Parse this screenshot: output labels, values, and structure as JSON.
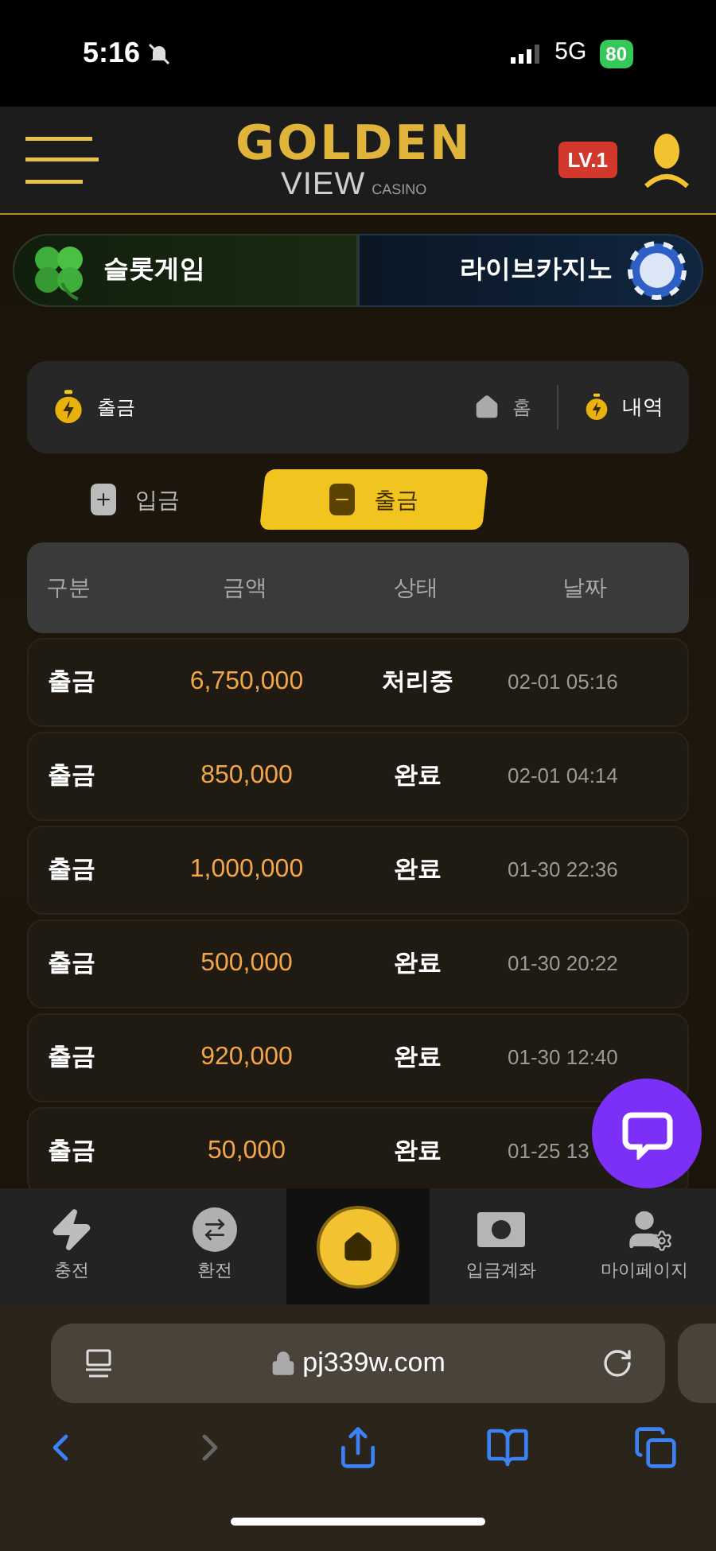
{
  "status_bar": {
    "time": "5:16",
    "network": "5G",
    "battery": "80"
  },
  "header": {
    "logo": {
      "title": "GOLDEN",
      "subtitle": "VIEW",
      "tag": "CASINO"
    },
    "level": "LV.1"
  },
  "game_tabs": [
    {
      "label": "슬롯게임",
      "kind": "slot"
    },
    {
      "label": "라이브카지노",
      "kind": "live"
    }
  ],
  "breadcrumb": {
    "title": "출금",
    "home": "홈",
    "history": "내역"
  },
  "tabs": [
    {
      "label": "입금",
      "kind": "deposit",
      "selected": false
    },
    {
      "label": "출금",
      "kind": "withdraw",
      "selected": true
    }
  ],
  "table": {
    "columns": [
      "구분",
      "금액",
      "상태",
      "날짜"
    ],
    "rows": [
      {
        "type": "출금",
        "amount": "6,750,000",
        "status": "처리중",
        "date": "02-01 05:16"
      },
      {
        "type": "출금",
        "amount": "850,000",
        "status": "완료",
        "date": "02-01 04:14"
      },
      {
        "type": "출금",
        "amount": "1,000,000",
        "status": "완료",
        "date": "01-30 22:36"
      },
      {
        "type": "출금",
        "amount": "500,000",
        "status": "완료",
        "date": "01-30 20:22"
      },
      {
        "type": "출금",
        "amount": "920,000",
        "status": "완료",
        "date": "01-30 12:40"
      },
      {
        "type": "출금",
        "amount": "50,000",
        "status": "완료",
        "date": "01-25 13"
      }
    ]
  },
  "bottom_nav": [
    {
      "label": "충전",
      "kind": "charge"
    },
    {
      "label": "환전",
      "kind": "exchange"
    },
    {
      "kind": "home"
    },
    {
      "label": "입금계좌",
      "kind": "account"
    },
    {
      "label": "마이페이지",
      "kind": "mypage"
    }
  ],
  "browser": {
    "url": "pj339w.com"
  }
}
